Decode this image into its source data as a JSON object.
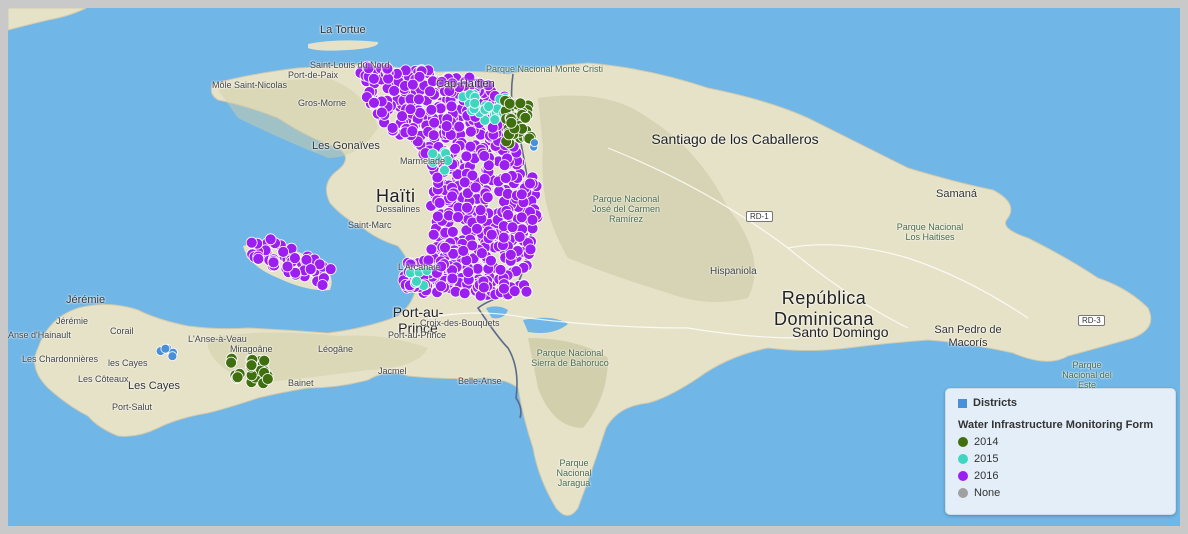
{
  "colors": {
    "water": "#70b6e6",
    "land": "#e6e2c8",
    "y2014": "#3f6f0f",
    "y2015": "#3fd6c1",
    "y2016": "#9b1ff0",
    "none": "#a0a0a0",
    "districts": "#4a90d9"
  },
  "legend": {
    "districts_label": "Districts",
    "form_title": "Water Infrastructure Monitoring Form",
    "items": [
      {
        "label": "2014",
        "color_key": "y2014"
      },
      {
        "label": "2015",
        "color_key": "y2015"
      },
      {
        "label": "2016",
        "color_key": "y2016"
      },
      {
        "label": "None",
        "color_key": "none"
      }
    ]
  },
  "labels": {
    "la_tortue": "La Tortue",
    "saint_louis": "Saint-Louis du Nord",
    "port_de_paix": "Port-de-Paix",
    "mole": "Môle Saint-Nicolas",
    "cap_haitien": "Cap-Haïtien",
    "monte_cristi_park": "Parque Nacional Monte Cristi",
    "gros_morne": "Gros-Morne",
    "gonaives": "Les Gonaïves",
    "marmelade": "Marmelade",
    "haiti": "Haïti",
    "dessalines": "Dessalines",
    "saint_marc": "Saint-Marc",
    "arcahaie": "L'Arcahaie",
    "santiago": "Santiago de los Caballeros",
    "samana": "Samaná",
    "jose_carmen_park": "Parque Nacional José del Carmen Ramírez",
    "haitises_park": "Parque Nacional Los Haitises",
    "rd1": "RD-1",
    "rd3": "RD-3",
    "hispaniola": "Hispaniola",
    "republica": "República Dominicana",
    "santo_domingo": "Santo Domingo",
    "san_pedro": "San Pedro de Macorís",
    "del_este_park": "Parque Nacional del Este",
    "port_au_prince": "Port-au-Prince",
    "port_au_prince_small": "Port-au-Prince",
    "croix": "Croix-des-Bouquets",
    "jeremie": "Jérémie",
    "jeremie_small": "Jérémie",
    "anse_veau": "L'Anse-à-Veau",
    "corail": "Corail",
    "anse_dhainault": "Anse d'Hainault",
    "chardonnieres": "Les Chardonnières",
    "miragoane": "Miragoâne",
    "leogane": "Léogâne",
    "cayes_small": "les Cayes",
    "coteaux": "Les Côteaux",
    "les_cayes": "Les Cayes",
    "port_salut": "Port-Salut",
    "bainet": "Bainet",
    "jacmel": "Jacmel",
    "belle_anse": "Belle-Anse",
    "bahoruco_park": "Parque Nacional Sierra de Bahoruco",
    "jaragua_park": "Parque Nacional Jaragua"
  }
}
